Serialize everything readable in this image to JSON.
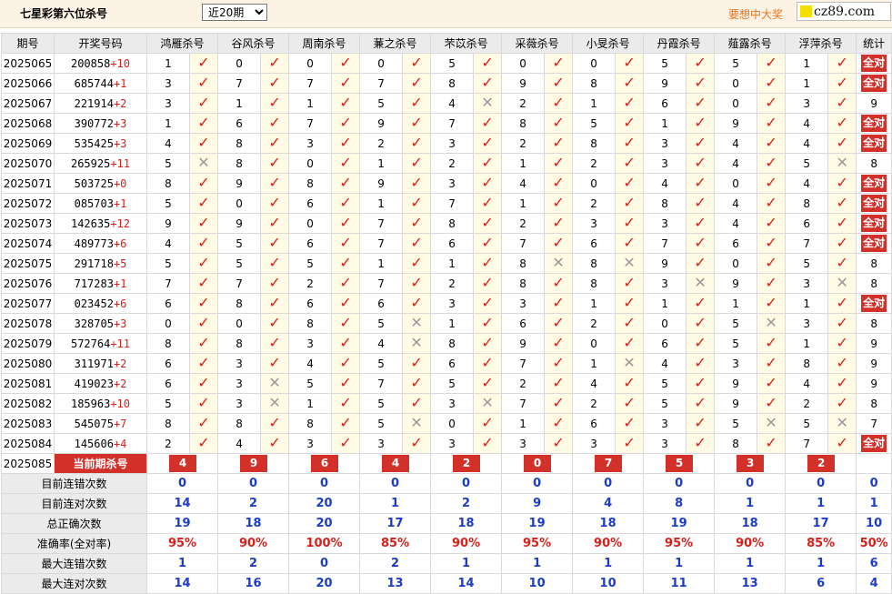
{
  "header": {
    "title": "七星彩第六位杀号",
    "period_selected": "近20期",
    "period_options": [
      "近20期"
    ],
    "slogan": "要想中大奖",
    "site": "cz89.com"
  },
  "columns": {
    "issue": "期号",
    "draw": "开奖号码",
    "experts": [
      "鸿雁杀号",
      "谷风杀号",
      "周南杀号",
      "蒹之杀号",
      "芣苡杀号",
      "采薇杀号",
      "小旻杀号",
      "丹霞杀号",
      "薤露杀号",
      "浮萍杀号"
    ],
    "total": "统计"
  },
  "rows": [
    {
      "issue": "2025065",
      "draw": "200858",
      "plus": "+10",
      "kills": [
        "1",
        "0",
        "0",
        "0",
        "5",
        "0",
        "0",
        "5",
        "5",
        "1"
      ],
      "hits": [
        1,
        1,
        1,
        1,
        1,
        1,
        1,
        1,
        1,
        1
      ],
      "total": "全对"
    },
    {
      "issue": "2025066",
      "draw": "685744",
      "plus": "+1",
      "kills": [
        "3",
        "7",
        "7",
        "7",
        "8",
        "9",
        "8",
        "9",
        "0",
        "1"
      ],
      "hits": [
        1,
        1,
        1,
        1,
        1,
        1,
        1,
        1,
        1,
        1
      ],
      "total": "全对"
    },
    {
      "issue": "2025067",
      "draw": "221914",
      "plus": "+2",
      "kills": [
        "3",
        "1",
        "1",
        "5",
        "4",
        "2",
        "1",
        "6",
        "0",
        "3"
      ],
      "hits": [
        1,
        1,
        1,
        1,
        0,
        1,
        1,
        1,
        1,
        1
      ],
      "total": "9"
    },
    {
      "issue": "2025068",
      "draw": "390772",
      "plus": "+3",
      "kills": [
        "1",
        "6",
        "7",
        "9",
        "7",
        "8",
        "5",
        "1",
        "9",
        "4"
      ],
      "hits": [
        1,
        1,
        1,
        1,
        1,
        1,
        1,
        1,
        1,
        1
      ],
      "total": "全对"
    },
    {
      "issue": "2025069",
      "draw": "535425",
      "plus": "+3",
      "kills": [
        "4",
        "8",
        "3",
        "2",
        "3",
        "2",
        "8",
        "3",
        "4",
        "4"
      ],
      "hits": [
        1,
        1,
        1,
        1,
        1,
        1,
        1,
        1,
        1,
        1
      ],
      "total": "全对"
    },
    {
      "issue": "2025070",
      "draw": "265925",
      "plus": "+11",
      "kills": [
        "5",
        "8",
        "0",
        "1",
        "2",
        "1",
        "2",
        "3",
        "4",
        "5"
      ],
      "hits": [
        0,
        1,
        1,
        1,
        1,
        1,
        1,
        1,
        1,
        0
      ],
      "total": "8"
    },
    {
      "issue": "2025071",
      "draw": "503725",
      "plus": "+0",
      "kills": [
        "8",
        "9",
        "8",
        "9",
        "3",
        "4",
        "0",
        "4",
        "0",
        "4"
      ],
      "hits": [
        1,
        1,
        1,
        1,
        1,
        1,
        1,
        1,
        1,
        1
      ],
      "total": "全对"
    },
    {
      "issue": "2025072",
      "draw": "085703",
      "plus": "+1",
      "kills": [
        "5",
        "0",
        "6",
        "1",
        "7",
        "1",
        "2",
        "8",
        "4",
        "8"
      ],
      "hits": [
        1,
        1,
        1,
        1,
        1,
        1,
        1,
        1,
        1,
        1
      ],
      "total": "全对"
    },
    {
      "issue": "2025073",
      "draw": "142635",
      "plus": "+12",
      "kills": [
        "9",
        "9",
        "0",
        "7",
        "8",
        "2",
        "3",
        "3",
        "4",
        "6"
      ],
      "hits": [
        1,
        1,
        1,
        1,
        1,
        1,
        1,
        1,
        1,
        1
      ],
      "total": "全对"
    },
    {
      "issue": "2025074",
      "draw": "489773",
      "plus": "+6",
      "kills": [
        "4",
        "5",
        "6",
        "7",
        "6",
        "7",
        "6",
        "7",
        "6",
        "7"
      ],
      "hits": [
        1,
        1,
        1,
        1,
        1,
        1,
        1,
        1,
        1,
        1
      ],
      "total": "全对"
    },
    {
      "issue": "2025075",
      "draw": "291718",
      "plus": "+5",
      "kills": [
        "5",
        "5",
        "5",
        "1",
        "1",
        "8",
        "8",
        "9",
        "0",
        "5"
      ],
      "hits": [
        1,
        1,
        1,
        1,
        1,
        0,
        0,
        1,
        1,
        1
      ],
      "total": "8"
    },
    {
      "issue": "2025076",
      "draw": "717283",
      "plus": "+1",
      "kills": [
        "7",
        "7",
        "2",
        "7",
        "2",
        "8",
        "8",
        "3",
        "9",
        "3"
      ],
      "hits": [
        1,
        1,
        1,
        1,
        1,
        1,
        1,
        0,
        1,
        0
      ],
      "total": "8"
    },
    {
      "issue": "2025077",
      "draw": "023452",
      "plus": "+6",
      "kills": [
        "6",
        "8",
        "6",
        "6",
        "3",
        "3",
        "1",
        "1",
        "1",
        "1"
      ],
      "hits": [
        1,
        1,
        1,
        1,
        1,
        1,
        1,
        1,
        1,
        1
      ],
      "total": "全对"
    },
    {
      "issue": "2025078",
      "draw": "328705",
      "plus": "+3",
      "kills": [
        "0",
        "0",
        "8",
        "5",
        "1",
        "6",
        "2",
        "0",
        "5",
        "3"
      ],
      "hits": [
        1,
        1,
        1,
        0,
        1,
        1,
        1,
        1,
        0,
        1
      ],
      "total": "8"
    },
    {
      "issue": "2025079",
      "draw": "572764",
      "plus": "+11",
      "kills": [
        "8",
        "8",
        "3",
        "4",
        "8",
        "9",
        "0",
        "6",
        "5",
        "1"
      ],
      "hits": [
        1,
        1,
        1,
        0,
        1,
        1,
        1,
        1,
        1,
        1
      ],
      "total": "9"
    },
    {
      "issue": "2025080",
      "draw": "311971",
      "plus": "+2",
      "kills": [
        "6",
        "3",
        "4",
        "5",
        "6",
        "7",
        "1",
        "4",
        "3",
        "8"
      ],
      "hits": [
        1,
        1,
        1,
        1,
        1,
        1,
        0,
        1,
        1,
        1
      ],
      "total": "9"
    },
    {
      "issue": "2025081",
      "draw": "419023",
      "plus": "+2",
      "kills": [
        "6",
        "3",
        "5",
        "7",
        "5",
        "2",
        "4",
        "5",
        "9",
        "4"
      ],
      "hits": [
        1,
        0,
        1,
        1,
        1,
        1,
        1,
        1,
        1,
        1
      ],
      "total": "9"
    },
    {
      "issue": "2025082",
      "draw": "185963",
      "plus": "+10",
      "kills": [
        "5",
        "3",
        "1",
        "5",
        "3",
        "7",
        "2",
        "5",
        "9",
        "2"
      ],
      "hits": [
        1,
        0,
        1,
        1,
        0,
        1,
        1,
        1,
        1,
        1
      ],
      "total": "8"
    },
    {
      "issue": "2025083",
      "draw": "545075",
      "plus": "+7",
      "kills": [
        "8",
        "8",
        "8",
        "5",
        "0",
        "1",
        "6",
        "3",
        "5",
        "5"
      ],
      "hits": [
        1,
        1,
        1,
        0,
        1,
        1,
        1,
        1,
        0,
        0
      ],
      "total": "7"
    },
    {
      "issue": "2025084",
      "draw": "145606",
      "plus": "+4",
      "kills": [
        "2",
        "4",
        "3",
        "3",
        "3",
        "3",
        "3",
        "3",
        "8",
        "7"
      ],
      "hits": [
        1,
        1,
        1,
        1,
        1,
        1,
        1,
        1,
        1,
        1
      ],
      "total": "全对"
    }
  ],
  "current": {
    "issue": "2025085",
    "label": "当前期杀号",
    "kills": [
      "4",
      "9",
      "6",
      "4",
      "2",
      "0",
      "7",
      "5",
      "3",
      "2"
    ]
  },
  "stats": [
    {
      "label": "目前连错次数",
      "values": [
        "0",
        "0",
        "0",
        "0",
        "0",
        "0",
        "0",
        "0",
        "0",
        "0"
      ],
      "total": "0",
      "pct": false
    },
    {
      "label": "目前连对次数",
      "values": [
        "14",
        "2",
        "20",
        "1",
        "2",
        "9",
        "4",
        "8",
        "1",
        "1"
      ],
      "total": "1",
      "pct": false
    },
    {
      "label": "总正确次数",
      "values": [
        "19",
        "18",
        "20",
        "17",
        "18",
        "19",
        "18",
        "19",
        "18",
        "17"
      ],
      "total": "10",
      "pct": false
    },
    {
      "label": "准确率(全对率)",
      "values": [
        "95%",
        "90%",
        "100%",
        "85%",
        "90%",
        "95%",
        "90%",
        "95%",
        "90%",
        "85%"
      ],
      "total": "50%",
      "pct": true
    },
    {
      "label": "最大连错次数",
      "values": [
        "1",
        "2",
        "0",
        "2",
        "1",
        "1",
        "1",
        "1",
        "1",
        "1"
      ],
      "total": "6",
      "pct": false
    },
    {
      "label": "最大连对次数",
      "values": [
        "14",
        "16",
        "20",
        "13",
        "14",
        "10",
        "10",
        "11",
        "13",
        "6"
      ],
      "total": "4",
      "pct": false
    }
  ],
  "icons": {
    "hit": "check-icon",
    "miss": "cross-icon"
  },
  "colors": {
    "accent": "#d3302a",
    "stat_blue": "#1a3cc9",
    "header_bg": "#fdf3e4"
  }
}
